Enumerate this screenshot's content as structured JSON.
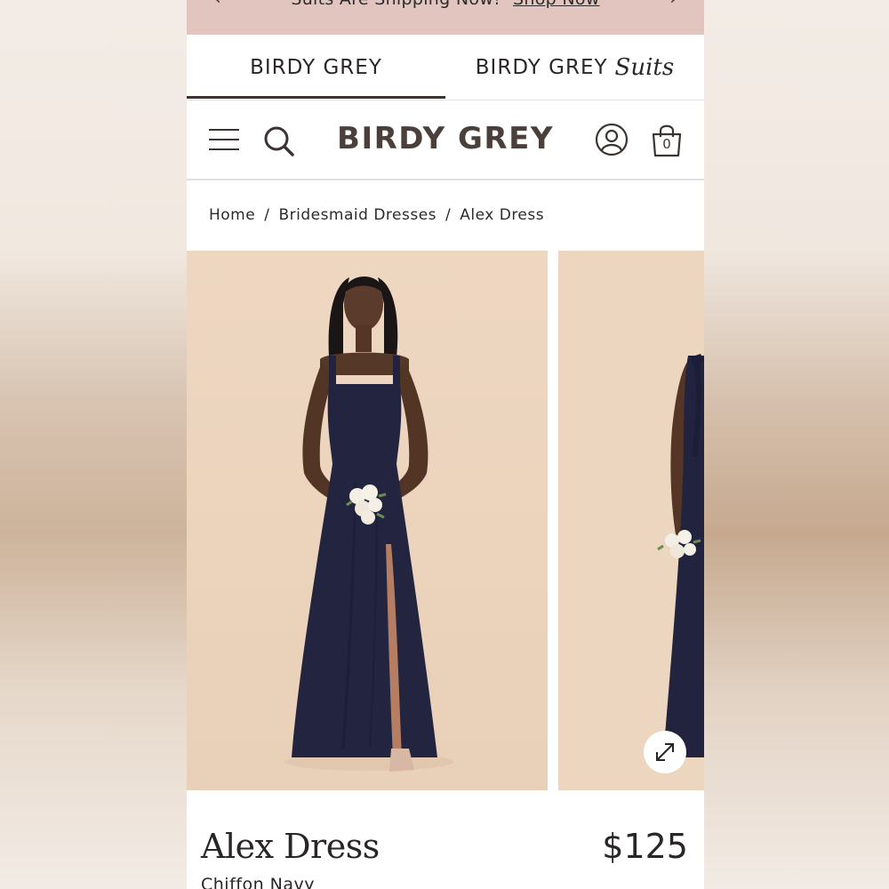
{
  "promo": {
    "text": "Suits Are Shipping Now!",
    "link": "Shop Now",
    "prev_icon": "chevron-left-icon",
    "next_icon": "chevron-right-icon"
  },
  "brand_tabs": [
    {
      "label": "BIRDY GREY",
      "suffix": "",
      "active": true
    },
    {
      "label": "BIRDY GREY",
      "suffix": "Suits",
      "active": false
    }
  ],
  "header": {
    "logo": "BIRDY GREY",
    "menu_icon": "hamburger-menu-icon",
    "search_icon": "search-icon",
    "account_icon": "user-account-icon",
    "bag_icon": "shopping-bag-icon",
    "bag_count": "0"
  },
  "breadcrumb": {
    "items": [
      "Home",
      "Bridesmaid Dresses",
      "Alex Dress"
    ],
    "separator": "/"
  },
  "gallery": {
    "expand_icon": "expand-arrows-icon",
    "background_color": "#ecd6bf",
    "dress_color": "#22233f"
  },
  "product": {
    "title": "Alex Dress",
    "price": "$125",
    "color": "Chiffon Navy"
  }
}
